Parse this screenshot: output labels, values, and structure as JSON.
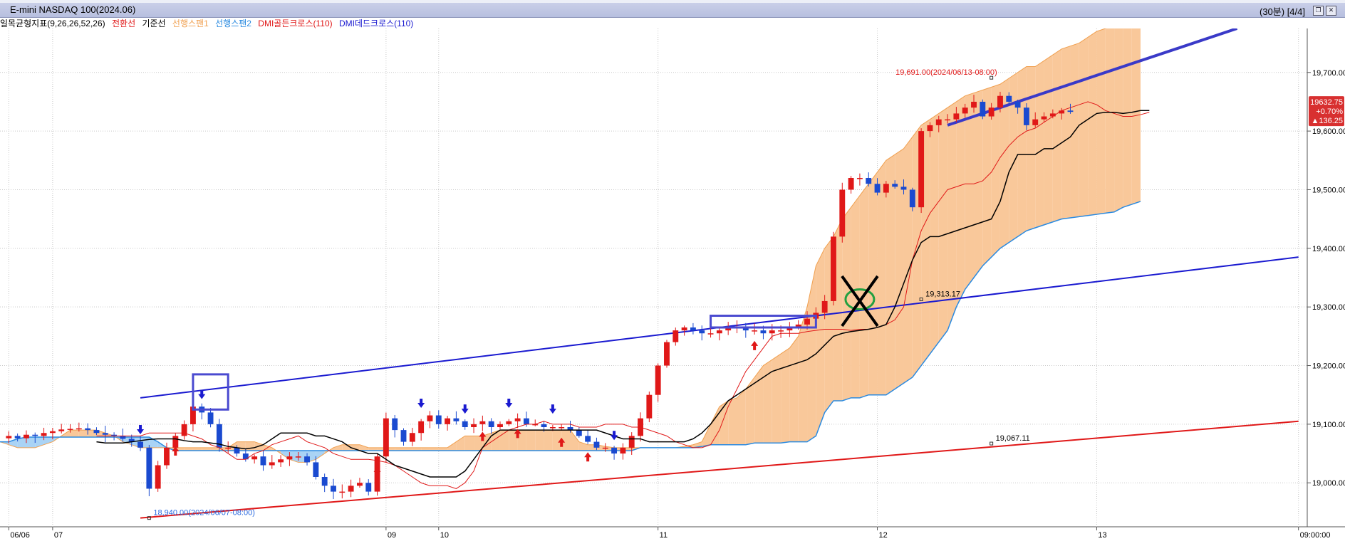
{
  "window": {
    "title": "E-mini NASDAQ 100(2024.06)",
    "period": "(30분) [4/4]",
    "buttons": [
      "❐",
      "✕"
    ]
  },
  "legend": [
    {
      "text": "일목균형지표(9,26,26,52,26)",
      "color": "#000000"
    },
    {
      "text": "전환선",
      "color": "#e01818"
    },
    {
      "text": "기준선",
      "color": "#000000"
    },
    {
      "text": "선행스팬1",
      "color": "#f0a050"
    },
    {
      "text": "선행스팬2",
      "color": "#2a8ae0"
    },
    {
      "text": "DMI골든크로스(110)",
      "color": "#e01818"
    },
    {
      "text": "DMI데드크로스(110)",
      "color": "#1a1ad0"
    }
  ],
  "chart_data": {
    "type": "candlestick",
    "title": "E-mini NASDAQ 100(2024.06)",
    "interval": "30분",
    "ylim": [
      18925,
      19775
    ],
    "y_ticks": [
      "19,000.00",
      "19,100.00",
      "19,200.00",
      "19,300.00",
      "19,400.00",
      "19,500.00",
      "19,600.00",
      "19,700.00"
    ],
    "y_tick_values": [
      19000,
      19100,
      19200,
      19300,
      19400,
      19500,
      19600,
      19700
    ],
    "x_ticks": [
      {
        "label": "06/06",
        "bar": 0
      },
      {
        "label": "07",
        "bar": 5
      },
      {
        "label": "09",
        "bar": 43
      },
      {
        "label": "10",
        "bar": 49
      },
      {
        "label": "11",
        "bar": 74
      },
      {
        "label": "12",
        "bar": 99
      },
      {
        "label": "13",
        "bar": 124
      },
      {
        "label": "09:00:00",
        "bar": 147
      }
    ],
    "bar_count": 148,
    "last_bar": 132,
    "price_series": [
      19080,
      19076,
      19082,
      19080,
      19085,
      19088,
      19091,
      19092,
      19093,
      19090,
      19085,
      19082,
      19080,
      19075,
      19070,
      19060,
      18990,
      19030,
      19060,
      19080,
      19100,
      19130,
      19120,
      19100,
      19060,
      19060,
      19050,
      19040,
      19045,
      19030,
      19035,
      19040,
      19045,
      19045,
      19035,
      19010,
      18995,
      18985,
      18985,
      18995,
      19000,
      18985,
      19045,
      19110,
      19090,
      19070,
      19085,
      19105,
      19115,
      19100,
      19110,
      19105,
      19095,
      19100,
      19105,
      19095,
      19100,
      19105,
      19110,
      19100,
      19100,
      19095,
      19095,
      19095,
      19090,
      19080,
      19070,
      19060,
      19060,
      19050,
      19060,
      19080,
      19110,
      19150,
      19200,
      19240,
      19260,
      19265,
      19260,
      19255,
      19255,
      19260,
      19265,
      19265,
      19260,
      19260,
      19255,
      19260,
      19260,
      19265,
      19270,
      19280,
      19290,
      19310,
      19420,
      19500,
      19520,
      19520,
      19510,
      19495,
      19510,
      19505,
      19500,
      19470,
      19600,
      19610,
      19620,
      19620,
      19630,
      19640,
      19650,
      19625,
      19640,
      19660,
      19650,
      19640,
      19610,
      19620,
      19625,
      19630,
      19635,
      19632.75
    ],
    "candles_seed": 7,
    "tenkan": [
      19080,
      19080,
      19080,
      19080,
      19080,
      19080,
      19085,
      19085,
      19085,
      19085,
      19085,
      19080,
      19075,
      19065,
      19060,
      19050,
      19040,
      19040,
      19050,
      19055,
      19065,
      19070,
      19075,
      19080,
      19070,
      19065,
      19060,
      19050,
      19045,
      19040,
      19040,
      19040,
      19038,
      19035,
      19030,
      19020,
      19010,
      19000,
      18995,
      18995,
      18995,
      18990,
      19000,
      19020,
      19060,
      19070,
      19080,
      19090,
      19095,
      19100,
      19100,
      19105,
      19100,
      19100,
      19100,
      19095,
      19095,
      19095,
      19100,
      19100,
      19100,
      19095,
      19095,
      19090,
      19085,
      19080,
      19070,
      19065,
      19060,
      19060,
      19065,
      19090,
      19130,
      19160,
      19190,
      19210,
      19230,
      19250,
      19255,
      19255,
      19255,
      19258,
      19260,
      19262,
      19262,
      19262,
      19260,
      19262,
      19262,
      19265,
      19270,
      19278,
      19300,
      19380,
      19430,
      19460,
      19480,
      19500,
      19505,
      19510,
      19510,
      19515,
      19530,
      19555,
      19575,
      19590,
      19600,
      19605,
      19615,
      19625,
      19635,
      19640,
      19645,
      19650,
      19645,
      19635,
      19630,
      19625,
      19625,
      19628,
      19632
    ],
    "kijun": [
      19070,
      19068,
      19068,
      19068,
      19070,
      19072,
      19074,
      19075,
      19075,
      19075,
      19072,
      19070,
      19070,
      19068,
      19066,
      19062,
      19060,
      19058,
      19060,
      19065,
      19075,
      19085,
      19085,
      19085,
      19085,
      19080,
      19080,
      19075,
      19070,
      19060,
      19055,
      19050,
      19050,
      19040,
      19030,
      19025,
      19020,
      19015,
      19010,
      19010,
      19010,
      19010,
      19020,
      19040,
      19060,
      19080,
      19090,
      19090,
      19090,
      19090,
      19090,
      19090,
      19090,
      19090,
      19090,
      19090,
      19090,
      19090,
      19085,
      19080,
      19075,
      19075,
      19075,
      19070,
      19070,
      19070,
      19070,
      19070,
      19075,
      19085,
      19100,
      19120,
      19140,
      19150,
      19160,
      19170,
      19180,
      19190,
      19195,
      19200,
      19205,
      19210,
      19220,
      19235,
      19250,
      19255,
      19258,
      19260,
      19262,
      19265,
      19270,
      19300,
      19340,
      19380,
      19410,
      19420,
      19420,
      19425,
      19430,
      19435,
      19440,
      19445,
      19450,
      19480,
      19530,
      19560,
      19560,
      19560,
      19570,
      19570,
      19580,
      19590,
      19610,
      19620,
      19630,
      19632,
      19632,
      19630,
      19632,
      19635,
      19635
    ],
    "span1": [
      19090,
      19090,
      19090,
      19090,
      19090,
      19090,
      19090,
      19090,
      19090,
      19085,
      19080,
      19075,
      19070,
      19065,
      19060,
      19060,
      19060,
      19065,
      19070,
      19080,
      19090,
      19090,
      19090,
      19090,
      19085,
      19080,
      19070,
      19065,
      19060,
      19060,
      19060,
      19060,
      19060,
      19060,
      19060,
      19060,
      19060,
      19060,
      19060,
      19070,
      19070,
      19070,
      19065,
      19060,
      19050,
      19040,
      19035,
      19035,
      19040,
      19050,
      19060,
      19065,
      19065,
      19065,
      19060,
      19060,
      19060,
      19060,
      19060,
      19060,
      19060,
      19060,
      19060,
      19060,
      19070,
      19080,
      19080,
      19080,
      19085,
      19090,
      19090,
      19090,
      19090,
      19090,
      19090,
      19090,
      19090,
      19090,
      19070,
      19065,
      19065,
      19062,
      19060,
      19060,
      19060,
      19060,
      19060,
      19060,
      19060,
      19060,
      19062,
      19065,
      19070,
      19100,
      19130,
      19140,
      19145,
      19160,
      19180,
      19200,
      19210,
      19220,
      19230,
      19250,
      19300,
      19370,
      19400,
      19420,
      19450,
      19470,
      19490,
      19510,
      19530,
      19550,
      19560,
      19570,
      19590,
      19610,
      19620,
      19630,
      19640,
      19650,
      19660,
      19665,
      19670,
      19675,
      19680,
      19690,
      19700,
      19710,
      19710,
      19720,
      19730,
      19740,
      19745,
      19750,
      19760,
      19770,
      19775,
      19780,
      19785,
      19785,
      19790
    ],
    "span2": [
      19000,
      19000,
      18990,
      18980,
      18985,
      18990,
      18995,
      19000,
      19010,
      19020,
      19040,
      19060,
      19070,
      19070,
      19075,
      19078,
      19078,
      19078,
      19078,
      19078,
      19078,
      19078,
      19078,
      19078,
      19078,
      19078,
      19078,
      19078,
      19078,
      19078,
      19070,
      19060,
      19055,
      19055,
      19055,
      19055,
      19055,
      19055,
      19055,
      19055,
      19055,
      19055,
      19055,
      19055,
      19055,
      19055,
      19055,
      19055,
      19055,
      19055,
      19055,
      19055,
      19055,
      19055,
      19055,
      19055,
      19055,
      19055,
      19055,
      19055,
      19055,
      19055,
      19055,
      19055,
      19055,
      19055,
      19055,
      19055,
      19055,
      19055,
      19055,
      19055,
      19055,
      19055,
      19055,
      19055,
      19055,
      19055,
      19055,
      19055,
      19055,
      19055,
      19055,
      19055,
      19055,
      19060,
      19060,
      19060,
      19060,
      19060,
      19060,
      19060,
      19062,
      19065,
      19065,
      19065,
      19065,
      19065,
      19068,
      19068,
      19068,
      19068,
      19070,
      19070,
      19070,
      19080,
      19120,
      19140,
      19140,
      19145,
      19145,
      19150,
      19150,
      19150,
      19160,
      19170,
      19180,
      19200,
      19220,
      19240,
      19260,
      19300,
      19330,
      19350,
      19370,
      19385,
      19400,
      19410,
      19420,
      19430,
      19435,
      19440,
      19445,
      19450,
      19452,
      19454,
      19456,
      19458,
      19460,
      19462,
      19470,
      19475,
      19480,
      19480,
      19480,
      19482
    ],
    "span_offset": -13,
    "golden_cross_bars": [
      19,
      42,
      54,
      58,
      63,
      66,
      85
    ],
    "dead_cross_bars": [
      15,
      22,
      47,
      52,
      57,
      62,
      69
    ],
    "lines": [
      {
        "name": "upper-channel-line",
        "color": "#1a1ad0",
        "from": {
          "bar": 15,
          "price": 19145
        },
        "to": {
          "bar": 147,
          "price": 19385
        }
      },
      {
        "name": "lower-channel-line",
        "color": "#e01818",
        "from": {
          "bar": 15,
          "price": 18940
        },
        "to": {
          "bar": 147,
          "price": 19105
        }
      },
      {
        "name": "top-trend-line",
        "color": "#3a3ac8",
        "from": {
          "bar": 107,
          "price": 19610
        },
        "to": {
          "bar": 140,
          "price": 19775
        }
      }
    ],
    "annotations": [
      {
        "text": "19,691.00(2024/06/13-08:00)",
        "color": "#e01818",
        "bar": 112,
        "price": 19691,
        "anchor": "end"
      },
      {
        "text": "18,940.00(2024/06/07-08:00)",
        "color": "#2a6ae0",
        "bar": 16,
        "price": 18940,
        "anchor": "start"
      },
      {
        "text": "19,313.17",
        "color": "#000000",
        "bar": 104,
        "price": 19313,
        "anchor": "start"
      },
      {
        "text": "19,067.11",
        "color": "#000000",
        "bar": 112,
        "price": 19067,
        "anchor": "start"
      }
    ],
    "boxes": [
      {
        "from": {
          "bar": 21,
          "price": 19185
        },
        "to": {
          "bar": 25,
          "price": 19125
        },
        "color": "#4a4ad0"
      },
      {
        "from": {
          "bar": 80,
          "price": 19285
        },
        "to": {
          "bar": 92,
          "price": 19265
        },
        "color": "#4a4ad0"
      }
    ],
    "cross_mark": {
      "bar": 97,
      "price": 19310
    },
    "circle_mark": {
      "bar": 97,
      "price": 19313
    },
    "current": {
      "price": "19632.75",
      "change_pct": "+0.70%",
      "change": "▲136.25"
    }
  }
}
